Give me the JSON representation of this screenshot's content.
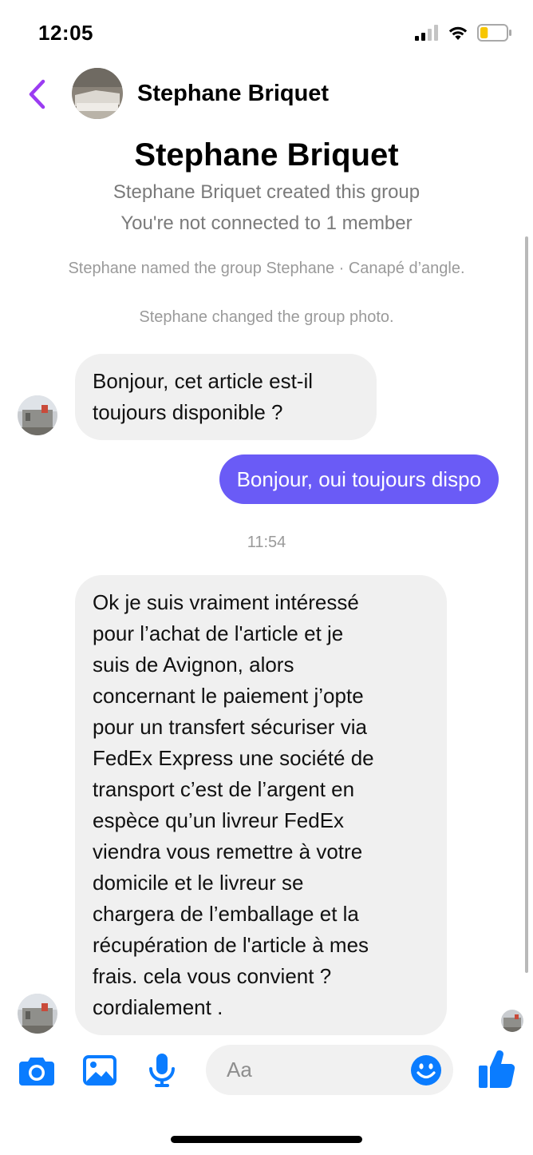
{
  "status_bar": {
    "time": "12:05"
  },
  "header": {
    "contact_name": "Stephane Briquet"
  },
  "group_info": {
    "title": "Stephane Briquet",
    "created_line": "Stephane Briquet created this group",
    "connection_line": "You're not connected to 1 member"
  },
  "system_messages": {
    "named": "Stephane named the group Stephane · Canapé d’angle.",
    "photo": "Stephane changed the group photo."
  },
  "messages": [
    {
      "direction": "incoming",
      "lines": [
        "Bonjour, cet article est-il",
        "toujours disponible ?"
      ]
    },
    {
      "direction": "outgoing",
      "text": "Bonjour, oui toujours dispo"
    },
    {
      "direction": "incoming",
      "lines": [
        "Ok je suis vraiment intéressé",
        "pour l’achat de l'article et je",
        "suis de Avignon, alors",
        "concernant le paiement j’opte",
        "pour un transfert sécuriser via",
        "FedEx Express une société de",
        "transport c’est de l’argent en",
        "espèce qu’un livreur FedEx",
        "viendra vous remettre à votre",
        "domicile et le livreur se",
        "chargera de l’emballage et la",
        "récupération de l'article  à mes",
        "frais. cela vous convient ?",
        "cordialement ."
      ]
    }
  ],
  "timestamp": "11:54",
  "composer": {
    "placeholder": "Aa",
    "icons": [
      "camera-icon",
      "gallery-icon",
      "microphone-icon",
      "emoji-icon",
      "thumbs-up-icon"
    ]
  },
  "colors": {
    "accent": "#0a7cff",
    "back_arrow": "#9b3cf2",
    "outgoing_bubble": "#6a5bf6",
    "incoming_bubble": "#f0f0f0",
    "battery_level": "#f7c600"
  },
  "battery_level": 0.3
}
